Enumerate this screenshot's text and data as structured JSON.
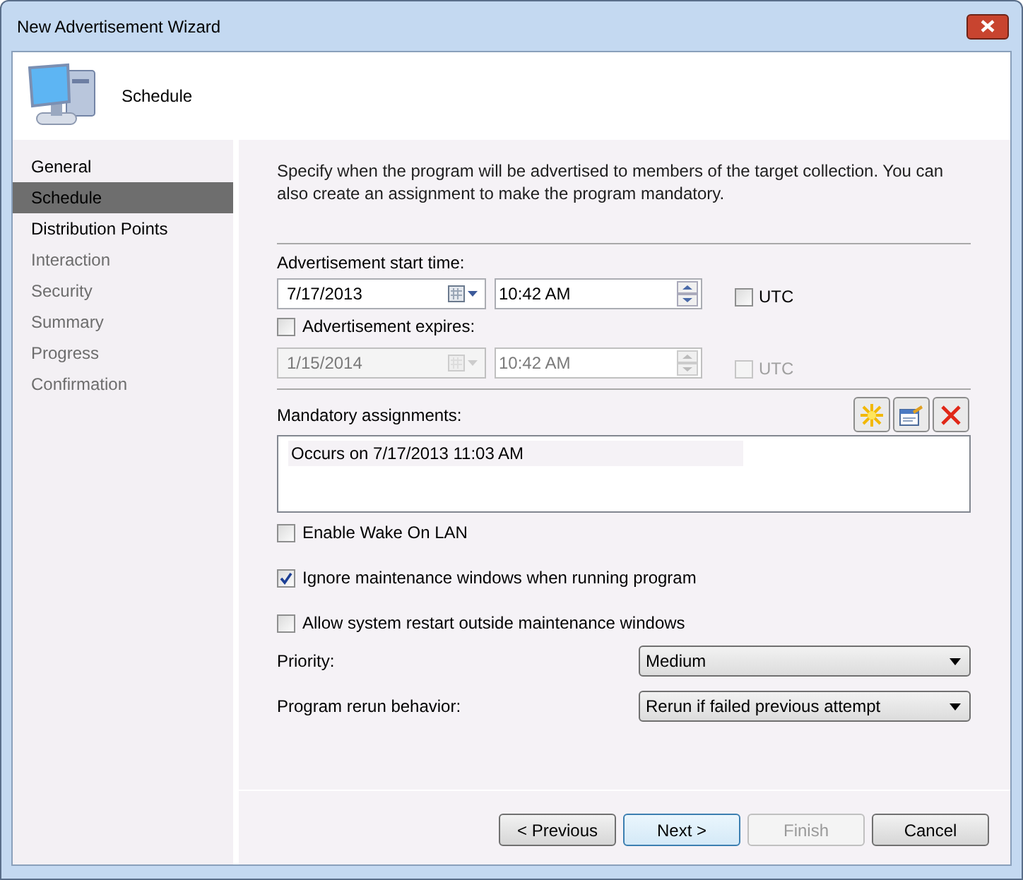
{
  "window": {
    "title": "New Advertisement Wizard"
  },
  "header": {
    "title": "Schedule"
  },
  "steps": [
    {
      "label": "General",
      "selected": false,
      "enabled": true
    },
    {
      "label": "Schedule",
      "selected": true,
      "enabled": true
    },
    {
      "label": "Distribution Points",
      "selected": false,
      "enabled": true
    },
    {
      "label": "Interaction",
      "selected": false,
      "enabled": false
    },
    {
      "label": "Security",
      "selected": false,
      "enabled": false
    },
    {
      "label": "Summary",
      "selected": false,
      "enabled": false
    },
    {
      "label": "Progress",
      "selected": false,
      "enabled": false
    },
    {
      "label": "Confirmation",
      "selected": false,
      "enabled": false
    }
  ],
  "description": "Specify when the program will be advertised to members of the target collection. You can also create an assignment to make the program mandatory.",
  "start_time": {
    "label": "Advertisement start time:",
    "date": "7/17/2013",
    "time": "10:42 AM",
    "disabled": false,
    "utc": {
      "label": "UTC",
      "checked": false,
      "disabled": false
    }
  },
  "expires": {
    "label": "Advertisement expires:",
    "checked": false,
    "date": "1/15/2014",
    "time": "10:42 AM",
    "disabled": true,
    "utc": {
      "label": "UTC",
      "checked": false,
      "disabled": true
    }
  },
  "mandatory": {
    "label": "Mandatory assignments:",
    "items": [
      "Occurs on 7/17/2013 11:03 AM"
    ]
  },
  "options": [
    {
      "label": "Enable Wake On LAN",
      "checked": false
    },
    {
      "label": "Ignore maintenance windows when running program",
      "checked": true
    },
    {
      "label": "Allow system restart outside maintenance windows",
      "checked": false
    }
  ],
  "dropdowns": [
    {
      "label": "Priority:",
      "value": "Medium"
    },
    {
      "label": "Program rerun behavior:",
      "value": "Rerun if failed previous attempt"
    }
  ],
  "buttons": [
    {
      "label": "< Previous",
      "kind": "normal"
    },
    {
      "label": "Next >",
      "kind": "default"
    },
    {
      "label": "Finish",
      "kind": "disabled"
    },
    {
      "label": "Cancel",
      "kind": "normal"
    }
  ]
}
